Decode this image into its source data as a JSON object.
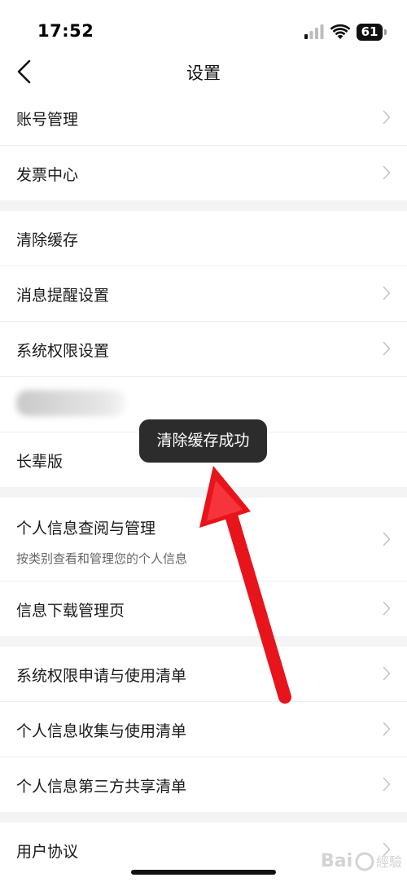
{
  "status_bar": {
    "time": "17:52",
    "battery": "61"
  },
  "header": {
    "title": "设置"
  },
  "groups": [
    {
      "items": [
        {
          "label": "账号管理"
        },
        {
          "label": "发票中心"
        }
      ]
    },
    {
      "items": [
        {
          "label": "清除缓存"
        },
        {
          "label": "消息提醒设置"
        },
        {
          "label": "系统权限设置"
        },
        {
          "label": ""
        },
        {
          "label": "长辈版"
        }
      ]
    },
    {
      "items": [
        {
          "label": "个人信息查阅与管理",
          "sub": "按类别查看和管理您的个人信息"
        },
        {
          "label": "信息下载管理页"
        }
      ]
    },
    {
      "items": [
        {
          "label": "系统权限申请与使用清单"
        },
        {
          "label": "个人信息收集与使用清单"
        },
        {
          "label": "个人信息第三方共享清单"
        }
      ]
    },
    {
      "items": [
        {
          "label": "用户协议"
        }
      ]
    }
  ],
  "toast": {
    "text": "清除缓存成功"
  },
  "colors": {
    "annotation_arrow": "#e8141c",
    "toast_bg": "#2c2c2c",
    "group_gap": "#f4f4f4"
  }
}
